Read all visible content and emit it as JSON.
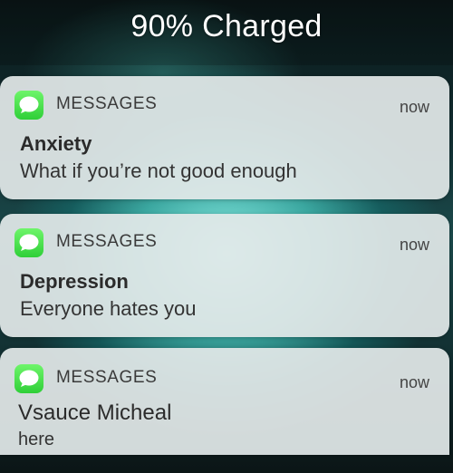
{
  "lockscreen": {
    "charge_status": "90% Charged"
  },
  "notifications": [
    {
      "app_icon": "messages-icon",
      "app_name": "MESSAGES",
      "time": "now",
      "title": "Anxiety",
      "body": "What if you’re not good enough"
    },
    {
      "app_icon": "messages-icon",
      "app_name": "MESSAGES",
      "time": "now",
      "title": "Depression",
      "body": "Everyone hates you"
    },
    {
      "app_icon": "messages-icon",
      "app_name": "MESSAGES",
      "time": "now",
      "line1": "Vsauce Micheal",
      "line2": "here"
    }
  ],
  "colors": {
    "icon_green": "#38d43f",
    "card": "#e2e8e8"
  }
}
